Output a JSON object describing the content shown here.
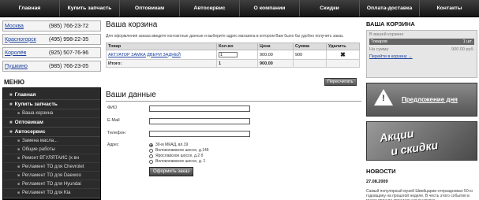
{
  "topnav": [
    "Главная",
    "Купить запчасть",
    "Оптовикам",
    "Автосервис",
    "О компании",
    "Скидки",
    "Оплата-доставка",
    "Контакты"
  ],
  "phones": [
    {
      "city": "Москва",
      "number": "(985) 766-23-72"
    },
    {
      "city": "Красногорск",
      "number": "(495) 998-22-35"
    },
    {
      "city": "Королёв",
      "number": "(925) 507-76-96"
    },
    {
      "city": "Пушкино",
      "number": "(985) 766-23-05"
    }
  ],
  "menu": {
    "title": "МЕНЮ",
    "items": [
      {
        "label": "Главная",
        "level": 1
      },
      {
        "label": "Купить запчасть",
        "level": 1
      },
      {
        "label": "Ваша корзина",
        "level": 2
      },
      {
        "label": "Оптовикам",
        "level": 1
      },
      {
        "label": "Автосервис",
        "level": 1
      },
      {
        "label": "Замена масла...",
        "level": 2
      },
      {
        "label": "Общие работы",
        "level": 2
      },
      {
        "label": "Ремонт ВТУЛЯТАИС (к вн",
        "level": 2
      },
      {
        "label": "Регламент ТО для Chevrolet",
        "level": 2
      },
      {
        "label": "Регламент ТО для Daewoo",
        "level": 2
      },
      {
        "label": "Регламент ТО для Hyundai",
        "level": 2
      },
      {
        "label": "Регламент ТО для Kia",
        "level": 2
      }
    ]
  },
  "main": {
    "cart_title": "Ваша корзина",
    "intro": "Для оформления заказа введите контактные данные и выберите адрес магазина в котором Вам было бы удобно получить заказ.",
    "table": {
      "headers": [
        "Товар",
        "Кол-во",
        "Цена",
        "Сумма",
        "Удалить"
      ],
      "rows": [
        {
          "name": "АКТУАТОР ЗАМКА ДВЕРИ ЗАДНЕЙ",
          "qty": "1",
          "price": "900.00",
          "sum": "900"
        }
      ],
      "total_label": "Итого:",
      "total_qty": "1",
      "total_sum": "900.00"
    },
    "recalc_label": "Пересчитать",
    "form_title": "Ваши данные",
    "fields": [
      {
        "label": "ФИО",
        "value": ""
      },
      {
        "label": "E-Mail",
        "value": ""
      },
      {
        "label": "Телефон",
        "value": ""
      }
    ],
    "address_label": "Адрес",
    "addresses": [
      {
        "label": "30-м МКАД, вл.19",
        "selected": true
      },
      {
        "label": "Волоколамское шоссе, д.146",
        "selected": false
      },
      {
        "label": "Ярославское шоссе, д.2 б",
        "selected": false
      },
      {
        "label": "Волоколамское шоссе, д. 1",
        "selected": false
      }
    ],
    "submit_label": "Оформить заказ"
  },
  "right": {
    "cart_title": "ВАША КОРЗИНА",
    "cart_box": {
      "caption": "В вашей корзине",
      "items_label": "Товаров",
      "items_value": "1 шт.",
      "sum_label": "На сумму",
      "sum_value": "900.00 руб.",
      "link": "Перейти в корзину →"
    },
    "banner1": "Предложение дня",
    "banner2_line1": "Акции",
    "banner2_line2": "и скидки",
    "news_title": "НОВОСТИ",
    "news_date": "27.08.2009",
    "news_text": "Самый популярный музей Швейцарии отпраздновал 50-ю годовщину на прошлой неделе. В честь этого события в музее прошла специальная выставка."
  },
  "colors": {
    "nav_bg": "#1f1f1f",
    "menu_bg": "#2b2b2b",
    "link": "#1a3fa0"
  }
}
